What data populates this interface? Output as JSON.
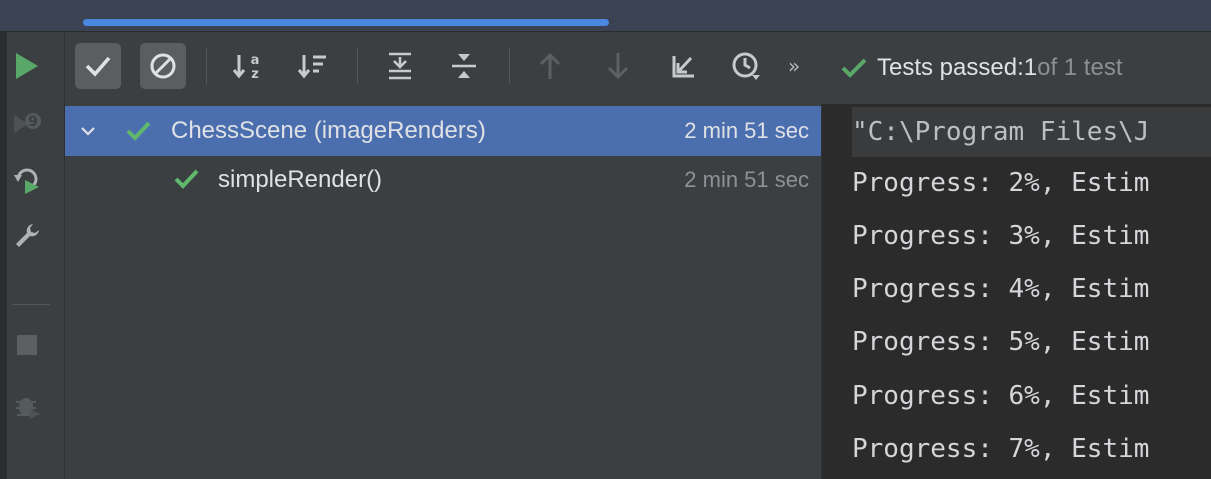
{
  "window": {
    "accent_color": "#4a88e0",
    "pass_color": "#59a869"
  },
  "left_toolbar": {
    "items": [
      {
        "icon": "run-icon"
      },
      {
        "icon": "rerun-failed-icon"
      },
      {
        "icon": "toggle-auto-test-icon"
      },
      {
        "icon": "wrench-icon"
      },
      {
        "icon": "stop-icon"
      },
      {
        "icon": "debug-icon"
      }
    ]
  },
  "toolbar": {
    "buttons": [
      {
        "icon": "show-passed-icon",
        "toggled": true
      },
      {
        "icon": "show-ignored-icon",
        "toggled": true
      },
      {
        "icon": "sort-alphabetically-icon"
      },
      {
        "icon": "sort-by-duration-icon"
      },
      {
        "icon": "expand-all-icon"
      },
      {
        "icon": "collapse-all-icon"
      },
      {
        "icon": "previous-failed-icon"
      },
      {
        "icon": "next-failed-icon"
      },
      {
        "icon": "import-tests-icon"
      },
      {
        "icon": "test-history-icon"
      }
    ],
    "more": "»"
  },
  "status": {
    "label": "Tests passed: ",
    "passed": "1",
    "rest": " of 1 test"
  },
  "tree": {
    "rows": [
      {
        "label": "ChessScene (imageRenders)",
        "duration": "2 min 51 sec",
        "selected": true,
        "expanded": true
      },
      {
        "label": "simpleRender()",
        "duration": "2 min 51 sec",
        "selected": false
      }
    ]
  },
  "console": {
    "command": "\"C:\\Program Files\\J",
    "lines": [
      "Progress: 2%, Estim",
      "Progress: 3%, Estim",
      "Progress: 4%, Estim",
      "Progress: 5%, Estim",
      "Progress: 6%, Estim",
      "Progress: 7%, Estim"
    ]
  }
}
